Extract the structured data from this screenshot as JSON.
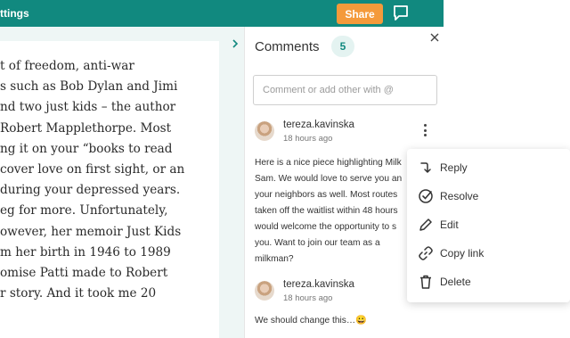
{
  "topbar": {
    "title": "ttings",
    "share_label": "Share",
    "chat_icon": "chat-bubble-icon"
  },
  "document": {
    "lines": [
      "t of freedom, anti-war",
      "s such as Bob Dylan and Jimi",
      "nd two just kids – the author",
      "Robert Mapplethorpe. Most",
      "ng it on your “books to read",
      " cover love on first sight, or an",
      " during your depressed years.",
      "eg for more. Unfortunately,",
      "owever, her memoir Just Kids",
      "m her birth in 1946 to 1989",
      "omise Patti made to Robert",
      "r story. And it took me 20"
    ]
  },
  "comments_panel": {
    "title": "Comments",
    "count": "5",
    "input_placeholder": "Comment or add other with @",
    "comments": [
      {
        "author": "tereza.kavinska",
        "time": "18 hours ago",
        "lines": [
          "Here is a nice piece highlighting Milk",
          "Sam.  We would love to serve you an",
          "your neighbors as well. Most routes",
          "taken off the waitlist within 48 hours",
          "would welcome the opportunity to s",
          "you.  Want to join our team as a",
          "milkman?"
        ]
      },
      {
        "author": "tereza.kavinska",
        "time": "18 hours ago",
        "lines": [
          "We should change this…😀"
        ]
      }
    ]
  },
  "context_menu": {
    "items": [
      {
        "label": "Reply",
        "icon": "reply-arrow-icon"
      },
      {
        "label": "Resolve",
        "icon": "check-circle-icon"
      },
      {
        "label": "Edit",
        "icon": "pencil-icon"
      },
      {
        "label": "Copy link",
        "icon": "link-icon"
      },
      {
        "label": "Delete",
        "icon": "trash-icon"
      }
    ]
  },
  "colors": {
    "brand_teal": "#11897f",
    "share_orange": "#f49a3b"
  }
}
